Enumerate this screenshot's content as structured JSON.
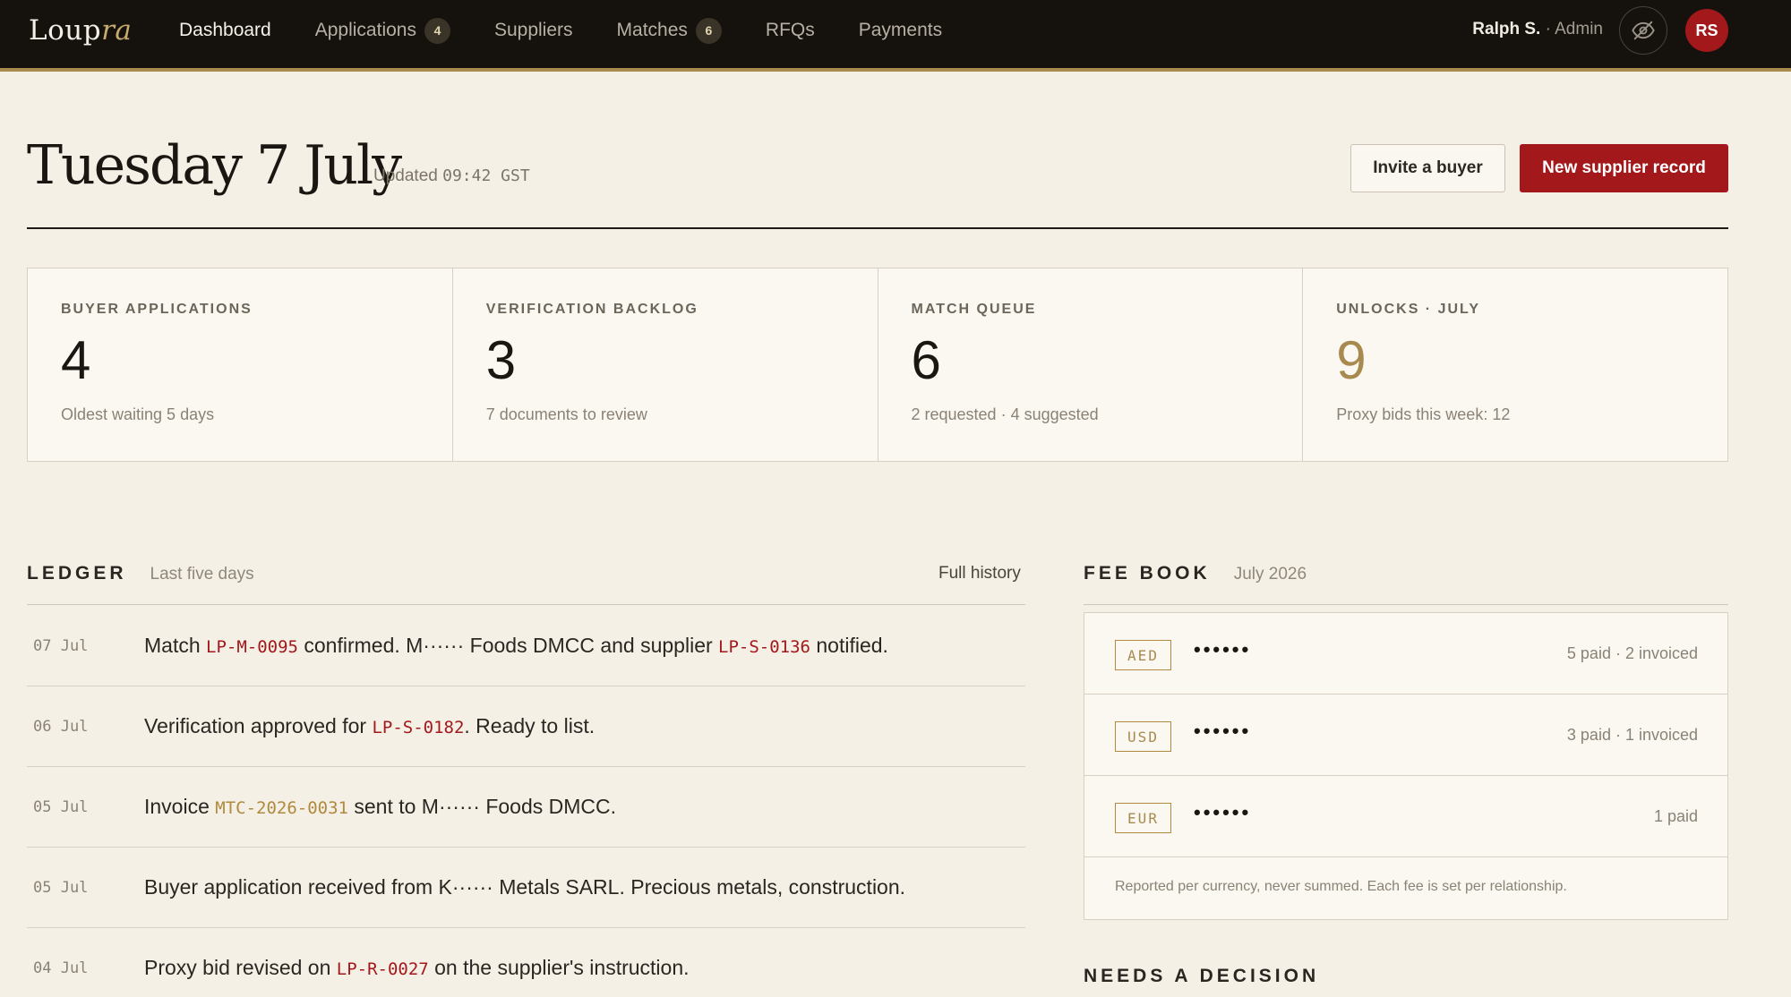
{
  "app": {
    "logo_main": "Loup",
    "logo_accent": "ra"
  },
  "nav": {
    "items": [
      {
        "label": "Dashboard",
        "badge": ""
      },
      {
        "label": "Applications",
        "badge": "4"
      },
      {
        "label": "Suppliers",
        "badge": ""
      },
      {
        "label": "Matches",
        "badge": "6"
      },
      {
        "label": "RFQs",
        "badge": ""
      },
      {
        "label": "Payments",
        "badge": ""
      }
    ],
    "active": "Dashboard",
    "user_name": "Ralph S.",
    "user_role": "· Admin",
    "avatar_initials": "RS",
    "privacy_icon": "eye-off-icon"
  },
  "header": {
    "title": "Tuesday 7 July",
    "updated_label": "Updated",
    "updated_time": "09:42 GST",
    "invite_button": "Invite a buyer",
    "new_supplier_button": "New supplier record"
  },
  "stats": [
    {
      "label": "BUYER APPLICATIONS",
      "value": "4",
      "sub": "Oldest waiting 5 days"
    },
    {
      "label": "VERIFICATION BACKLOG",
      "value": "3",
      "sub": "7 documents to review"
    },
    {
      "label": "MATCH QUEUE",
      "value": "6",
      "sub": "2 requested · 4 suggested"
    },
    {
      "label": "UNLOCKS · JULY",
      "value": "9",
      "sub": "Proxy bids this week: 12"
    }
  ],
  "ledger": {
    "title": "LEDGER",
    "subtitle": "Last five days",
    "full_history": "Full history",
    "rows": [
      {
        "date": "07 Jul",
        "a": "Match ",
        "code1": "LP-M-0095",
        "b": " confirmed. M······ Foods DMCC and supplier ",
        "code2": "LP-S-0136",
        "c": " notified."
      },
      {
        "date": "06 Jul",
        "a": "Verification approved for ",
        "code1": "LP-S-0182",
        "b": ". Ready to list.",
        "code2": "",
        "c": ""
      },
      {
        "date": "05 Jul",
        "a": "Invoice ",
        "code1": "MTC-2026-0031",
        "b": " sent to M······ Foods DMCC.",
        "code2": "",
        "c": ""
      },
      {
        "date": "05 Jul",
        "a": "Buyer application received from K······ Metals SARL. Precious metals, construction.",
        "code1": "",
        "b": "",
        "code2": "",
        "c": ""
      },
      {
        "date": "04 Jul",
        "a": "Proxy bid revised on ",
        "code1": "LP-R-0027",
        "b": " on the supplier's instruction.",
        "code2": "",
        "c": ""
      }
    ]
  },
  "fee_book": {
    "title": "FEE BOOK",
    "subtitle": "July 2026",
    "rows": [
      {
        "currency": "AED",
        "masked": "••••••",
        "status": "5 paid · 2 invoiced"
      },
      {
        "currency": "USD",
        "masked": "••••••",
        "status": "3 paid · 1 invoiced"
      },
      {
        "currency": "EUR",
        "masked": "••••••",
        "status": "1 paid"
      }
    ],
    "note": "Reported per currency, never summed. Each fee is set per relationship."
  },
  "needs_decision": {
    "title": "NEEDS A DECISION"
  },
  "colors": {
    "brand_red": "#a3181b",
    "gold": "#a88a4f",
    "nav_bg": "#15120e",
    "page_bg": "#f5f0e6"
  }
}
